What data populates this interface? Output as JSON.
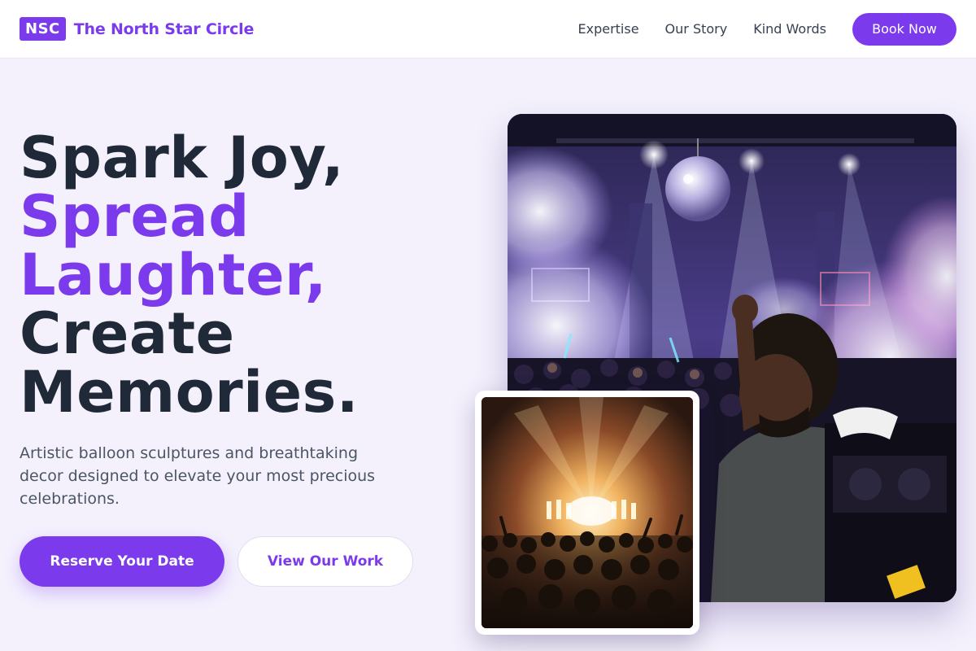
{
  "header": {
    "logo_abbr": "NSC",
    "brand_name": "The North Star Circle",
    "nav": [
      "Expertise",
      "Our Story",
      "Kind Words"
    ],
    "cta": "Book Now"
  },
  "hero": {
    "headline": {
      "line1": "Spark Joy,",
      "line2": "Spread",
      "line3": "Laughter,",
      "line4": "Create",
      "line5": "Memories."
    },
    "subtext": "Artistic balloon sculptures and breathtaking decor designed to elevate your most precious celebrations.",
    "primary_button": "Reserve Your Date",
    "secondary_button": "View Our Work"
  },
  "images": {
    "main": "nightclub-dj-photo",
    "secondary": "concert-crowd-photo"
  },
  "colors": {
    "accent": "#7c3aed",
    "text_dark": "#1f2937",
    "text_muted": "#4b5563",
    "background": "#f4f1fd"
  }
}
